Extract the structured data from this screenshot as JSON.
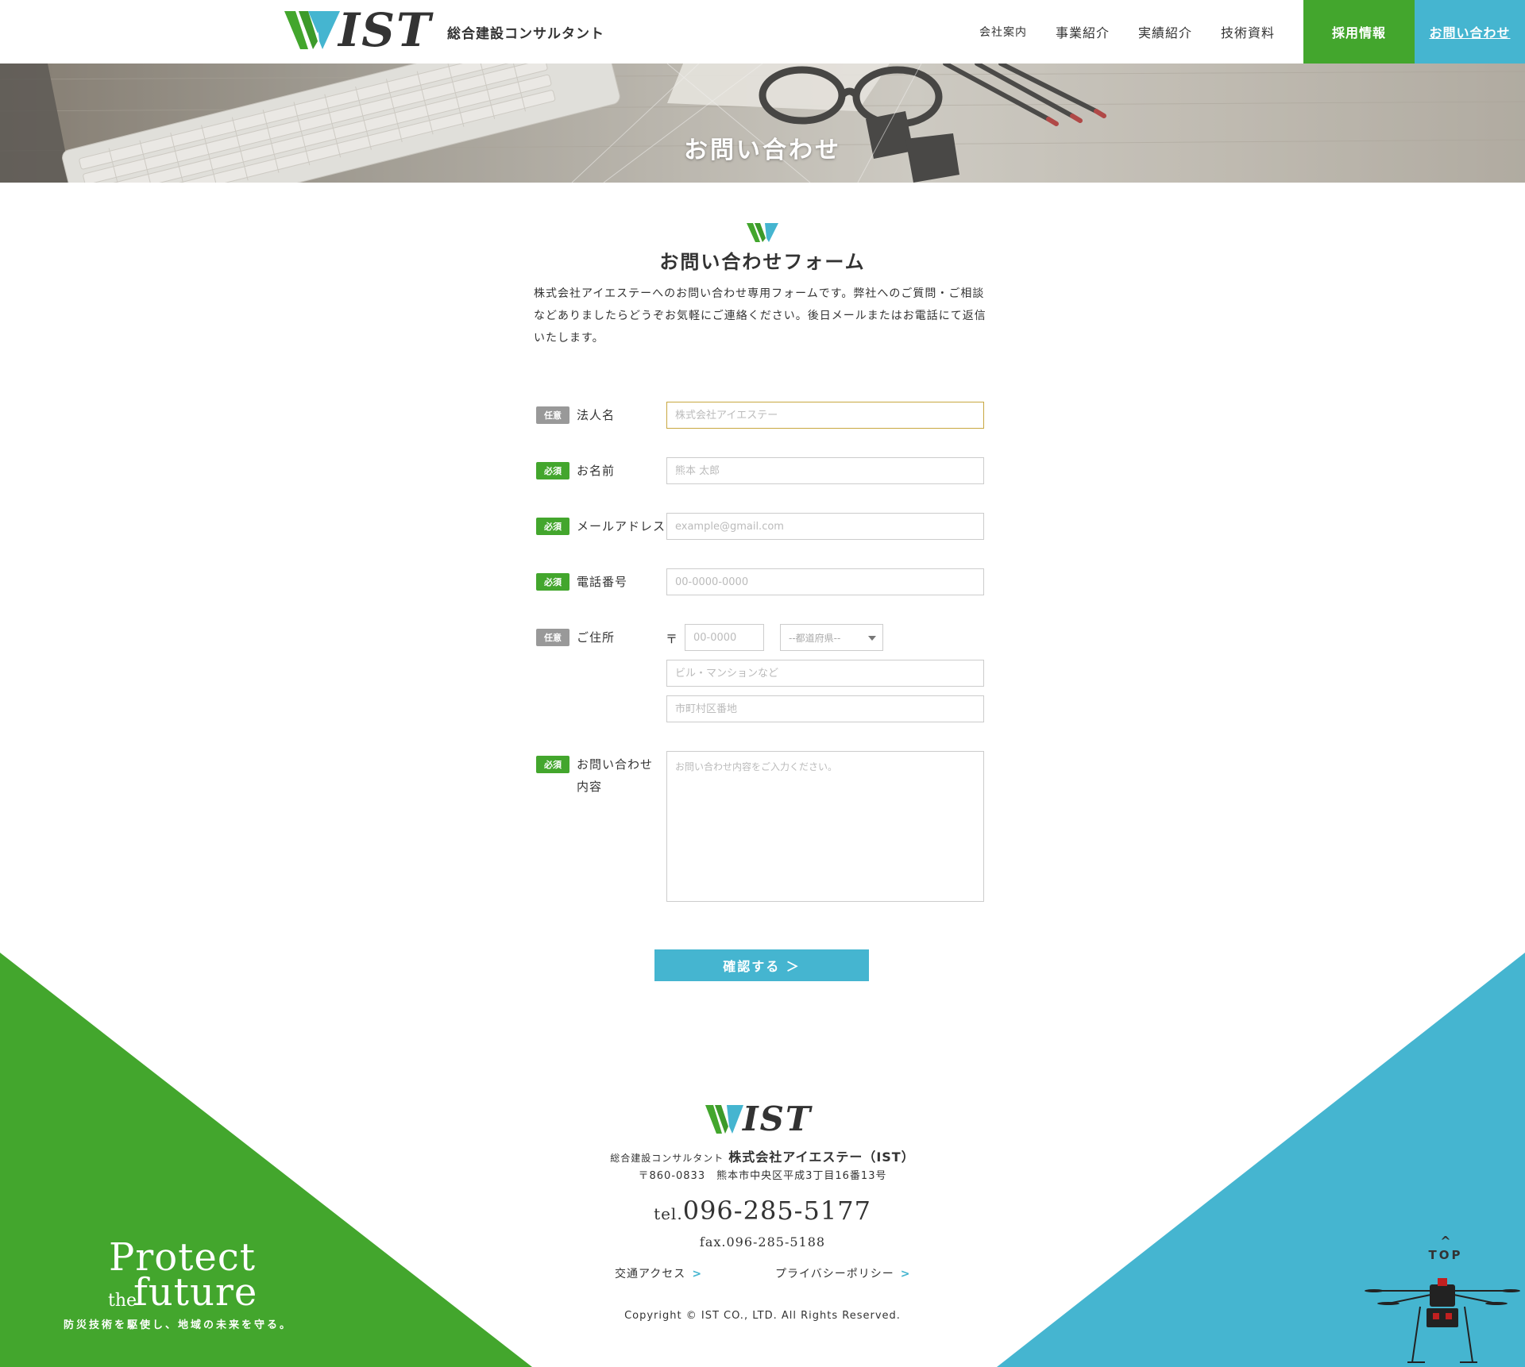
{
  "header": {
    "logo_text": "IST",
    "tagline": "総合建設コンサルタント",
    "nav": [
      "会社案内",
      "事業紹介",
      "実績紹介",
      "技術資料"
    ],
    "nav_recruit": "採用情報",
    "nav_contact": "お問い合わせ"
  },
  "hero": {
    "title": "お問い合わせ"
  },
  "section": {
    "title": "お問い合わせフォーム",
    "intro": "株式会社アイエステーへのお問い合わせ専用フォームです。弊社へのご質問・ご相談などありましたらどうぞお気軽にご連絡ください。後日メールまたはお電話にて返信いたします。"
  },
  "form": {
    "badge_optional": "任意",
    "badge_required": "必須",
    "company": {
      "label": "法人名",
      "placeholder": "株式会社アイエステー"
    },
    "name": {
      "label": "お名前",
      "placeholder": "熊本 太郎"
    },
    "email": {
      "label": "メールアドレス",
      "placeholder": "example@gmail.com"
    },
    "phone": {
      "label": "電話番号",
      "placeholder": "00-0000-0000"
    },
    "address": {
      "label": "ご住所",
      "postal_mark": "〒",
      "postal_placeholder": "00-0000",
      "prefecture_selected": "--都道府県--",
      "building_placeholder": "ビル・マンションなど",
      "city_placeholder": "市町村区番地"
    },
    "message": {
      "label_line1": "お問い合わせ",
      "label_line2": "内容",
      "placeholder": "お問い合わせ内容をご入力ください。"
    },
    "submit": "確認する ＞"
  },
  "footer": {
    "slogan_line1": "Protect",
    "slogan_the": "the",
    "slogan_line2": "future",
    "slogan_sub": "防災技術を駆使し、地域の未来を守る。",
    "logo_text": "IST",
    "company_prefix": "総合建設コンサルタント",
    "company_name": "株式会社アイエステー（IST）",
    "address": "〒860-0833　熊本市中央区平成3丁目16番13号",
    "tel_prefix": "tel.",
    "tel": "096-285-5177",
    "fax": "fax.096-285-5188",
    "link_access": "交通アクセス",
    "link_privacy": "プライバシーポリシー",
    "link_arrow": ">",
    "copyright": "Copyright © IST CO., LTD. All Rights Reserved.",
    "top_arrow": "^",
    "top_label": "TOP"
  },
  "colors": {
    "green": "#43a62d",
    "blue": "#45b5d0",
    "gray_badge": "#999999"
  }
}
